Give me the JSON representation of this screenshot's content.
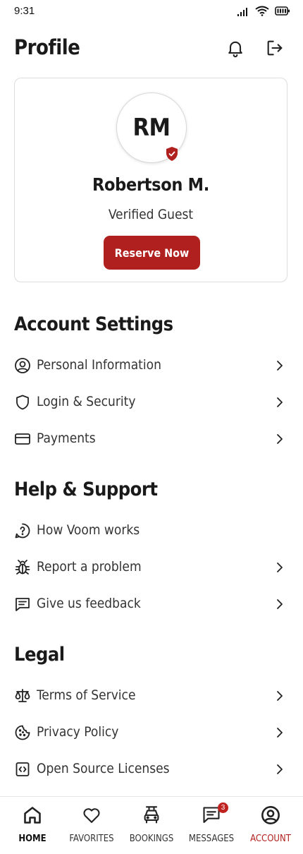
{
  "status_bar": {
    "time": "9:31"
  },
  "header": {
    "title": "Profile"
  },
  "profile": {
    "initials": "RM",
    "name": "Robertson M.",
    "role": "Verified Guest",
    "reserve_label": "Reserve Now"
  },
  "account_settings": {
    "title": "Account Settings",
    "items": [
      {
        "label": "Personal Information",
        "icon": "user-circle-icon"
      },
      {
        "label": "Login & Security",
        "icon": "shield-icon"
      },
      {
        "label": "Payments",
        "icon": "credit-card-icon"
      }
    ]
  },
  "help_support": {
    "title": "Help & Support",
    "items": [
      {
        "label": "How Voom works",
        "icon": "help-circle-icon"
      },
      {
        "label": "Report a problem",
        "icon": "bug-icon"
      },
      {
        "label": "Give us feedback",
        "icon": "message-square-icon"
      }
    ]
  },
  "legal": {
    "title": "Legal",
    "items": [
      {
        "label": "Terms of Service",
        "icon": "scale-icon"
      },
      {
        "label": "Privacy Policy",
        "icon": "cookie-icon"
      },
      {
        "label": "Open Source Licenses",
        "icon": "code-file-icon"
      }
    ]
  },
  "bottom_nav": {
    "items": [
      {
        "label": "HOME",
        "icon": "home-icon"
      },
      {
        "label": "FAVORITES",
        "icon": "heart-icon"
      },
      {
        "label": "BOOKINGS",
        "icon": "car-icon"
      },
      {
        "label": "MESSAGES",
        "icon": "chat-icon",
        "badge": "3"
      },
      {
        "label": "ACCOUNT",
        "icon": "account-icon"
      }
    ]
  },
  "colors": {
    "accent": "#b0201e",
    "text": "#1a1a1a",
    "border": "#dcdcdc"
  }
}
